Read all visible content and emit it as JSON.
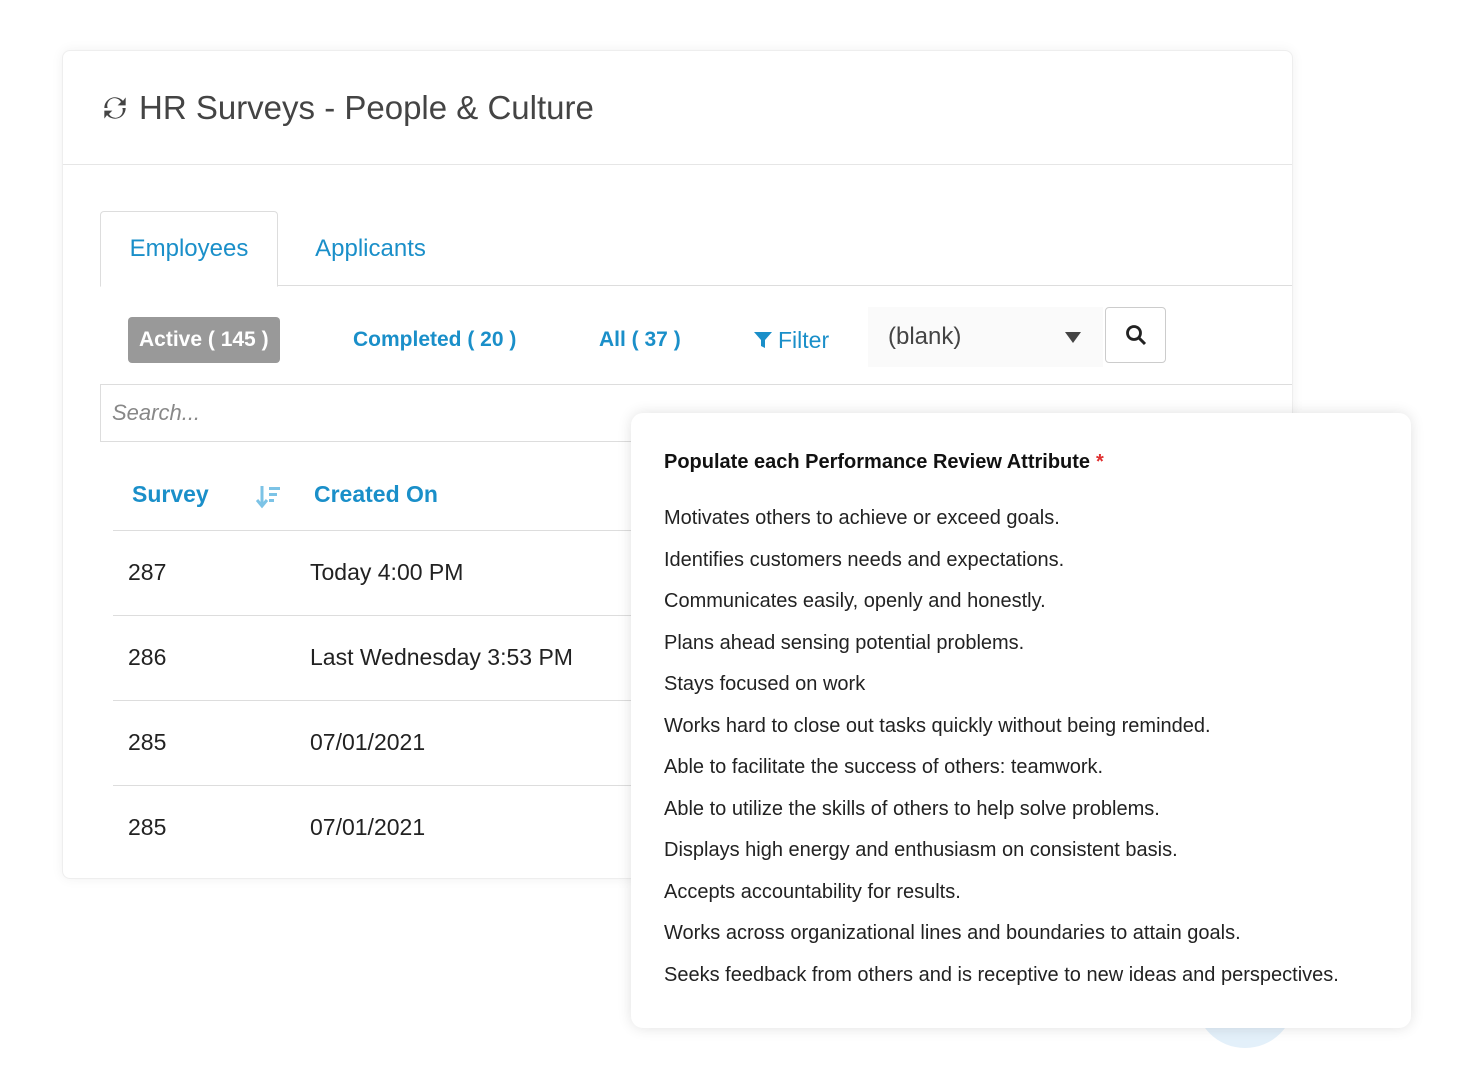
{
  "app": {
    "title": "HR Surveys - People & Culture",
    "icon": "refresh-icon"
  },
  "tabs": [
    {
      "label": "Employees",
      "active": true
    },
    {
      "label": "Applicants",
      "active": false
    }
  ],
  "filters": {
    "active": "Active ( 145 )",
    "completed": "Completed ( 20 )",
    "all": "All ( 37 )",
    "filter_label": "Filter",
    "select_value": "(blank)"
  },
  "search": {
    "placeholder": "Search..."
  },
  "table": {
    "columns": [
      "Survey",
      "Created On"
    ],
    "rows": [
      [
        "287",
        "Today 4:00 PM"
      ],
      [
        "286",
        "Last Wednesday 3:53 PM"
      ],
      [
        "285",
        "07/01/2021"
      ],
      [
        "285",
        "07/01/2021"
      ]
    ]
  },
  "popup": {
    "title": "Populate each Performance Review Attribute",
    "required_mark": "*",
    "attributes": [
      "Motivates others to achieve or exceed goals.",
      "Identifies customers needs and expectations.",
      "Communicates easily, openly and honestly.",
      "Plans ahead sensing potential problems.",
      "Stays focused on work",
      "Works hard to close out tasks quickly without being reminded.",
      "Able to facilitate the success of others: teamwork.",
      "Able to utilize the skills of others to help solve problems.",
      "Displays high energy and enthusiasm on consistent basis.",
      "Accepts accountability for results.",
      "Works across organizational lines and boundaries to attain goals.",
      "Seeks feedback from others and is receptive to new ideas and perspectives."
    ]
  },
  "colors": {
    "accent": "#1a8fc9",
    "active_pill": "#999999",
    "required": "#e03030"
  }
}
